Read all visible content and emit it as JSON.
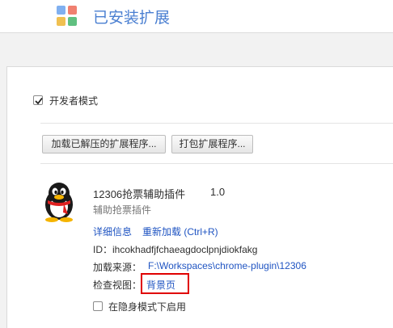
{
  "header": {
    "title": "已安装扩展",
    "logo_icon": "extensions-grid-icon",
    "logo_colors": [
      "#80b0f0",
      "#f08070",
      "#f0c050",
      "#60c080"
    ]
  },
  "developer_mode": {
    "label": "开发者模式",
    "checked": true
  },
  "buttons": {
    "load_unpacked": "加载已解压的扩展程序...",
    "pack": "打包扩展程序..."
  },
  "extension": {
    "icon": "qq-penguin-icon",
    "name": "12306抢票辅助插件",
    "version": "1.0",
    "description": "辅助抢票插件",
    "details_link": "详细信息",
    "reload_link": "重新加载 (Ctrl+R)",
    "id_label": "ID：",
    "id_value": "ihcokhadfjfchaeagdoclpnjdiokfakg",
    "source_label": "加载来源：",
    "source_path": "F:\\Workspaces\\chrome-plugin\\12306",
    "inspect_label": "检查视图：",
    "inspect_link": "背景页",
    "incognito_label": "在隐身模式下启用",
    "incognito_checked": false
  },
  "colors": {
    "accent": "#4a7fd1",
    "link": "#1f54c2",
    "highlight": "#e00000"
  }
}
